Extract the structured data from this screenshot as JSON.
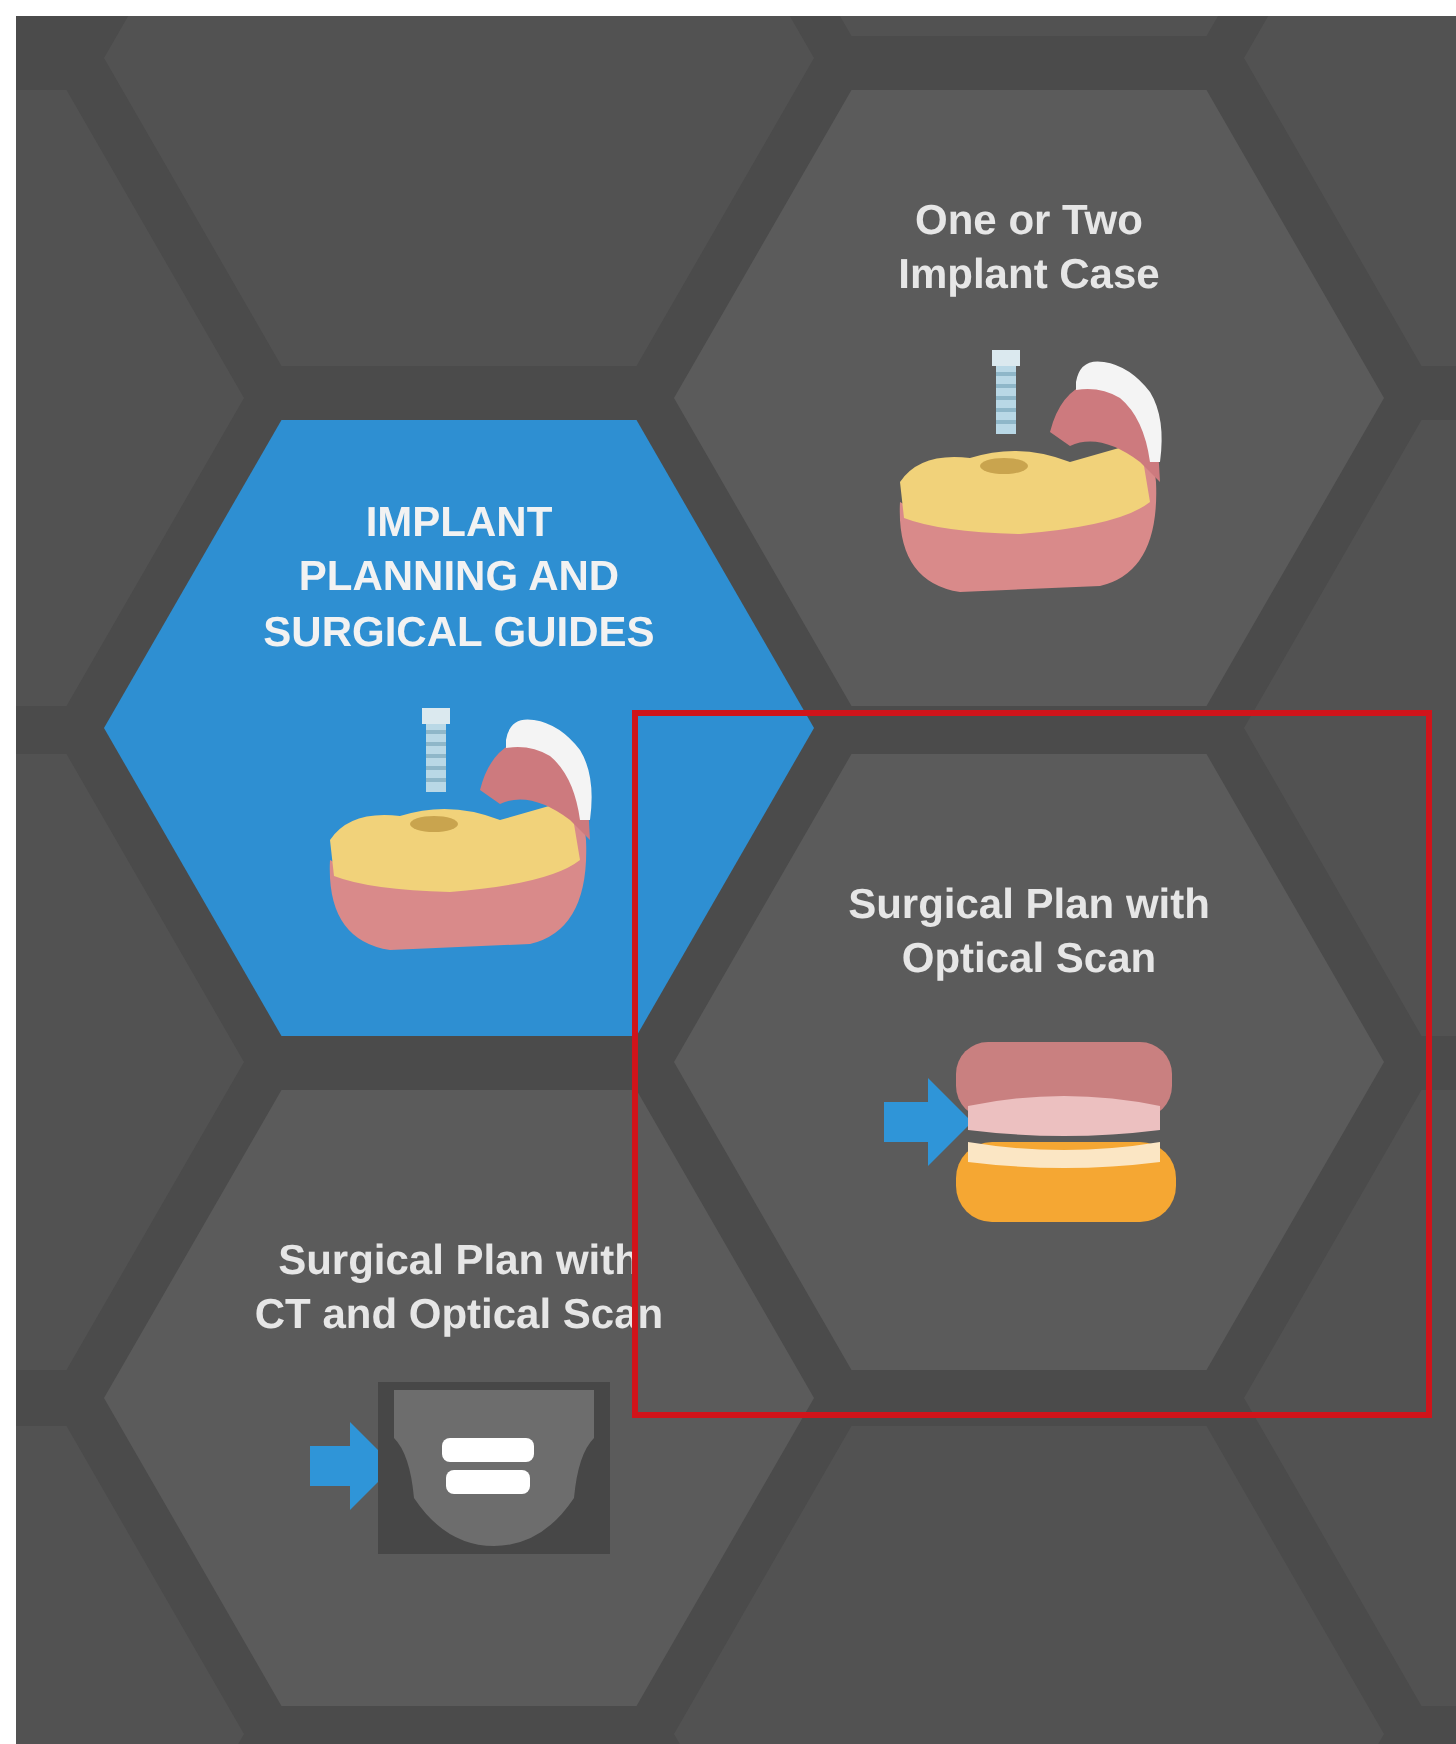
{
  "tiles": [
    {
      "title": "One or Two\nImplant Case",
      "kind": "implant",
      "selected": false,
      "highlighted": false
    },
    {
      "title": "IMPLANT\nPLANNING AND\nSURGICAL GUIDES",
      "kind": "implant",
      "selected": true,
      "highlighted": false
    },
    {
      "title": "Surgical Plan with\nOptical Scan",
      "kind": "optical-scan",
      "selected": false,
      "highlighted": true
    },
    {
      "title": "Surgical Plan with\nCT and Optical Scan",
      "kind": "ct-scan",
      "selected": false,
      "highlighted": false
    }
  ]
}
